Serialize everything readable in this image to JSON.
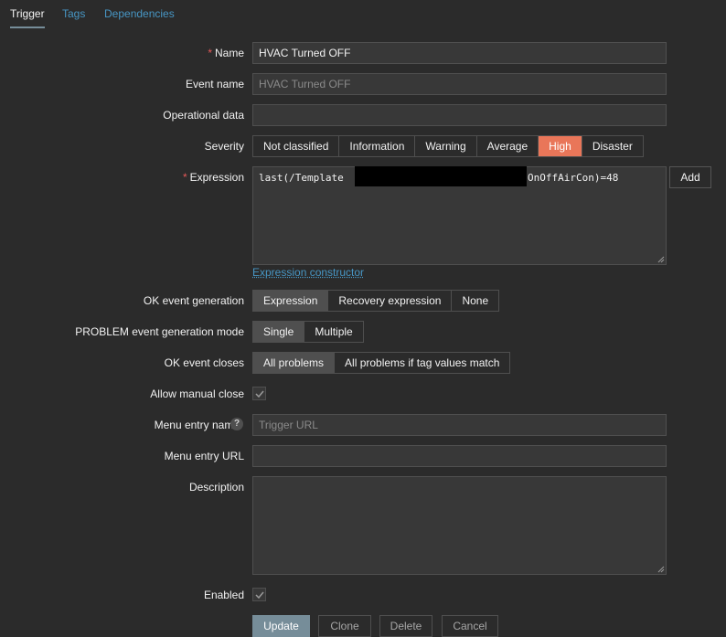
{
  "tabs": [
    "Trigger",
    "Tags",
    "Dependencies"
  ],
  "form": {
    "name_label": "Name",
    "name_value": "HVAC Turned OFF",
    "event_name_label": "Event name",
    "event_name_placeholder": "HVAC Turned OFF",
    "operational_data_label": "Operational data",
    "severity_label": "Severity",
    "severity_options": [
      "Not classified",
      "Information",
      "Warning",
      "Average",
      "High",
      "Disaster"
    ],
    "severity_selected": "High",
    "expression_label": "Expression",
    "expression_visible_start": "last(/Template ",
    "expression_visible_end": "OnOffAirCon)=48",
    "add_button": "Add",
    "expression_constructor_link": "Expression constructor",
    "ok_event_generation_label": "OK event generation",
    "ok_event_generation_options": [
      "Expression",
      "Recovery expression",
      "None"
    ],
    "ok_event_generation_selected": "Expression",
    "problem_mode_label": "PROBLEM event generation mode",
    "problem_mode_options": [
      "Single",
      "Multiple"
    ],
    "problem_mode_selected": "Single",
    "ok_event_closes_label": "OK event closes",
    "ok_event_closes_options": [
      "All problems",
      "All problems if tag values match"
    ],
    "ok_event_closes_selected": "All problems",
    "allow_manual_close_label": "Allow manual close",
    "allow_manual_close_checked": true,
    "menu_entry_name_label": "Menu entry name",
    "menu_entry_name_placeholder": "Trigger URL",
    "menu_entry_url_label": "Menu entry URL",
    "description_label": "Description",
    "enabled_label": "Enabled",
    "enabled_checked": true
  },
  "actions": {
    "update": "Update",
    "clone": "Clone",
    "delete": "Delete",
    "cancel": "Cancel"
  },
  "colors": {
    "background": "#2b2b2b",
    "accent_link": "#4796c4",
    "severity_high": "#e97659",
    "primary_button": "#768d99",
    "required_marker": "#e45959"
  }
}
